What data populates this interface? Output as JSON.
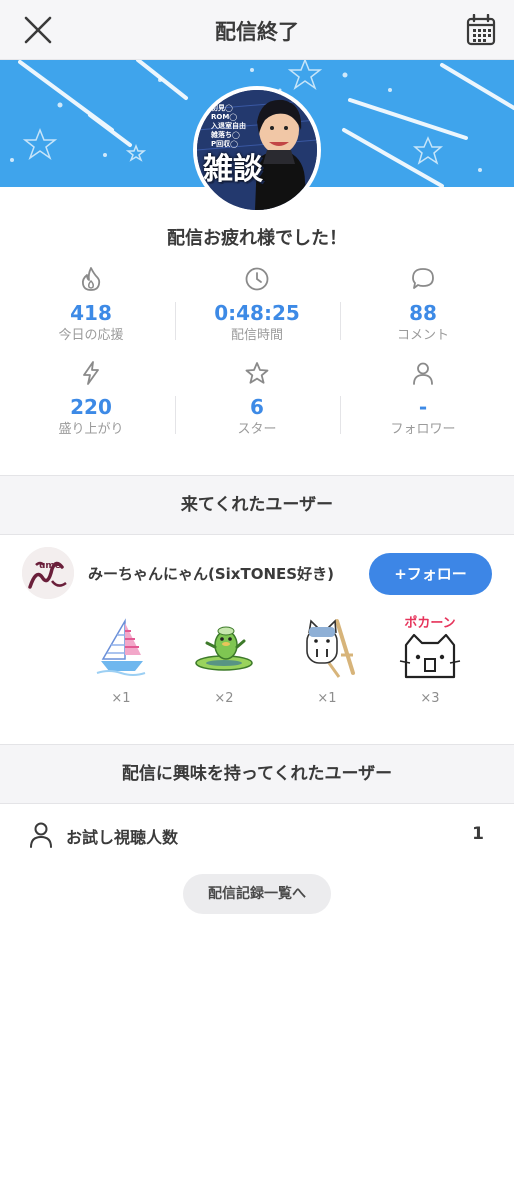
{
  "header": {
    "title": "配信終了",
    "close_icon": "close-icon",
    "calendar_icon": "calendar-icon"
  },
  "banner": {
    "bg_color": "#3fa4ec",
    "avatar_overlay_text": "雑談",
    "avatar_lines": [
      "初見◯",
      "ROM◯",
      "入退室自由",
      "雑落ち◯",
      "P回収◯"
    ]
  },
  "greeting": "配信お疲れ様でした！",
  "stats": [
    {
      "icon": "flame-icon",
      "value": "418",
      "label": "今日の応援"
    },
    {
      "icon": "clock-icon",
      "value": "0:48:25",
      "label": "配信時間"
    },
    {
      "icon": "comment-icon",
      "value": "88",
      "label": "コメント"
    },
    {
      "icon": "lightning-icon",
      "value": "220",
      "label": "盛り上がり"
    },
    {
      "icon": "star-icon",
      "value": "6",
      "label": "スター"
    },
    {
      "icon": "person-icon",
      "value": "-",
      "label": "フォロワー"
    }
  ],
  "visitors": {
    "heading": "来てくれたユーザー",
    "user": {
      "name": "みーちゃんにゃん(SixTONES好き)",
      "avatar_text": "ume",
      "follow_label": "+フォロー"
    },
    "gifts": [
      {
        "icon": "sailboat-icon",
        "count": "×1"
      },
      {
        "icon": "surfing-kappa-icon",
        "count": "×2"
      },
      {
        "icon": "cat-on-chair-icon",
        "count": "×1"
      },
      {
        "icon": "pokan-cat-icon",
        "count": "×3",
        "caption": "ポカーン"
      }
    ]
  },
  "interested": {
    "heading": "配信に興味を持ってくれたユーザー",
    "trial_label": "お試し視聴人数",
    "trial_value": "1"
  },
  "history_button": "配信記録一覧へ",
  "colors": {
    "accent": "#3d86e6",
    "stat_value": "#3d8ae6"
  }
}
